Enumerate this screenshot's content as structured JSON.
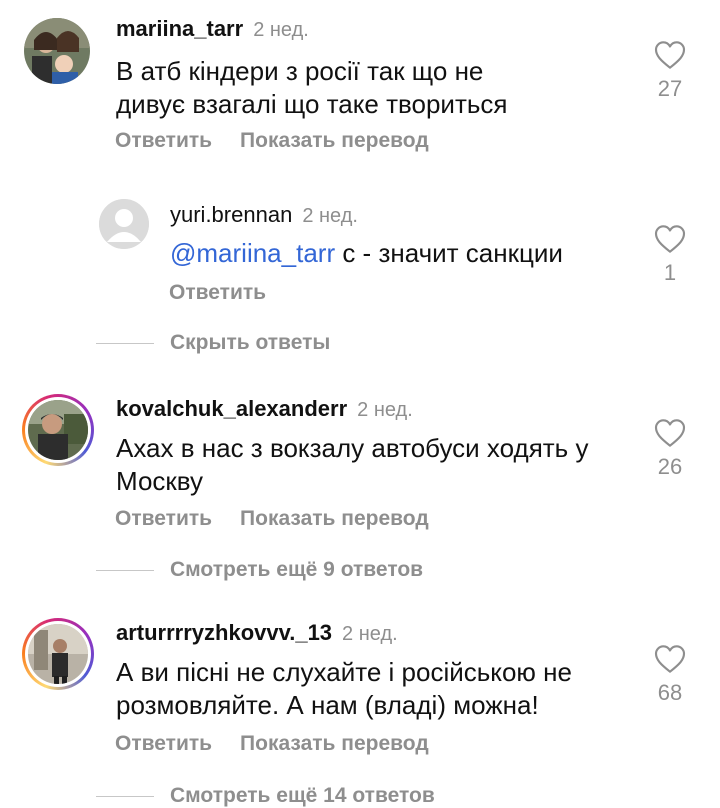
{
  "comments": [
    {
      "username": "mariina_tarr",
      "time": "2 нед.",
      "text": "В атб кіндери з росії так що не дивує взагалі що таке твориться",
      "likes": "27",
      "actions": [
        "Ответить",
        "Показать перевод"
      ]
    },
    {
      "username": "yuri.brennan",
      "time": "2 нед.",
      "mention": "@mariina_tarr",
      "text": " с - значит санкции",
      "likes": "1",
      "actions": [
        "Ответить"
      ]
    },
    {
      "username": "kovalchuk_alexanderr",
      "time": "2 нед.",
      "text": "Ахах в нас з вокзалу автобуси ходять у Москву",
      "likes": "26",
      "actions": [
        "Ответить",
        "Показать перевод"
      ]
    },
    {
      "username": "arturrrryzhkovvv._13",
      "time": "2 нед.",
      "text": "А ви пісні не слухайте і російською не розмовляйте. А нам (владі) можна!",
      "likes": "68",
      "actions": [
        "Ответить",
        "Показать перевод"
      ]
    }
  ],
  "threads": {
    "hide_replies": "Скрыть ответы",
    "view_more_1": "Смотреть ещё 9 ответов",
    "view_more_2": "Смотреть ещё 14 ответов"
  },
  "icons": {
    "like": "heart-outline-icon",
    "default_avatar": "default-avatar-icon"
  },
  "colors": {
    "text": "#111111",
    "muted": "#8e8e8e",
    "mention": "#3366d6"
  }
}
